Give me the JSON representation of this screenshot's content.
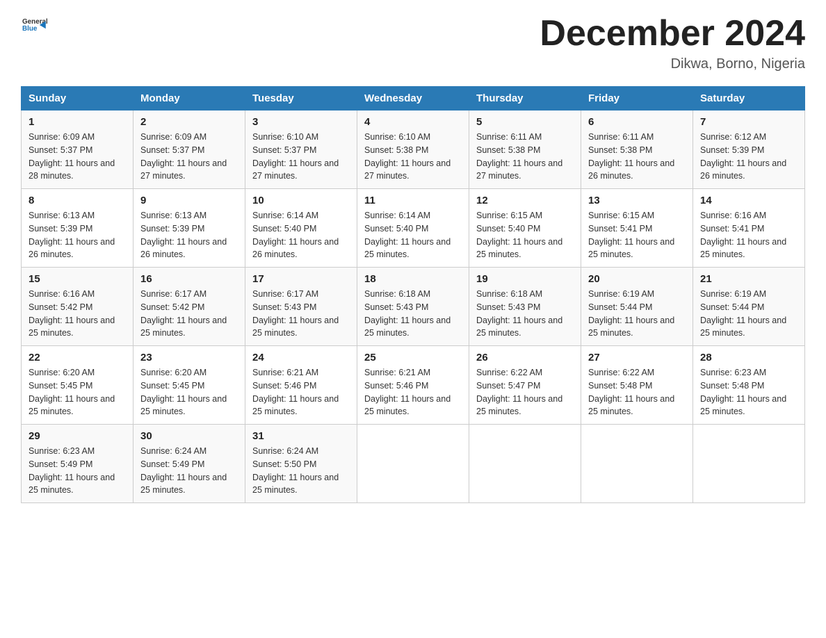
{
  "header": {
    "logo_general": "General",
    "logo_blue": "Blue",
    "month_title": "December 2024",
    "location": "Dikwa, Borno, Nigeria"
  },
  "weekdays": [
    "Sunday",
    "Monday",
    "Tuesday",
    "Wednesday",
    "Thursday",
    "Friday",
    "Saturday"
  ],
  "weeks": [
    [
      {
        "day": "1",
        "sunrise": "6:09 AM",
        "sunset": "5:37 PM",
        "daylight": "11 hours and 28 minutes."
      },
      {
        "day": "2",
        "sunrise": "6:09 AM",
        "sunset": "5:37 PM",
        "daylight": "11 hours and 27 minutes."
      },
      {
        "day": "3",
        "sunrise": "6:10 AM",
        "sunset": "5:37 PM",
        "daylight": "11 hours and 27 minutes."
      },
      {
        "day": "4",
        "sunrise": "6:10 AM",
        "sunset": "5:38 PM",
        "daylight": "11 hours and 27 minutes."
      },
      {
        "day": "5",
        "sunrise": "6:11 AM",
        "sunset": "5:38 PM",
        "daylight": "11 hours and 27 minutes."
      },
      {
        "day": "6",
        "sunrise": "6:11 AM",
        "sunset": "5:38 PM",
        "daylight": "11 hours and 26 minutes."
      },
      {
        "day": "7",
        "sunrise": "6:12 AM",
        "sunset": "5:39 PM",
        "daylight": "11 hours and 26 minutes."
      }
    ],
    [
      {
        "day": "8",
        "sunrise": "6:13 AM",
        "sunset": "5:39 PM",
        "daylight": "11 hours and 26 minutes."
      },
      {
        "day": "9",
        "sunrise": "6:13 AM",
        "sunset": "5:39 PM",
        "daylight": "11 hours and 26 minutes."
      },
      {
        "day": "10",
        "sunrise": "6:14 AM",
        "sunset": "5:40 PM",
        "daylight": "11 hours and 26 minutes."
      },
      {
        "day": "11",
        "sunrise": "6:14 AM",
        "sunset": "5:40 PM",
        "daylight": "11 hours and 25 minutes."
      },
      {
        "day": "12",
        "sunrise": "6:15 AM",
        "sunset": "5:40 PM",
        "daylight": "11 hours and 25 minutes."
      },
      {
        "day": "13",
        "sunrise": "6:15 AM",
        "sunset": "5:41 PM",
        "daylight": "11 hours and 25 minutes."
      },
      {
        "day": "14",
        "sunrise": "6:16 AM",
        "sunset": "5:41 PM",
        "daylight": "11 hours and 25 minutes."
      }
    ],
    [
      {
        "day": "15",
        "sunrise": "6:16 AM",
        "sunset": "5:42 PM",
        "daylight": "11 hours and 25 minutes."
      },
      {
        "day": "16",
        "sunrise": "6:17 AM",
        "sunset": "5:42 PM",
        "daylight": "11 hours and 25 minutes."
      },
      {
        "day": "17",
        "sunrise": "6:17 AM",
        "sunset": "5:43 PM",
        "daylight": "11 hours and 25 minutes."
      },
      {
        "day": "18",
        "sunrise": "6:18 AM",
        "sunset": "5:43 PM",
        "daylight": "11 hours and 25 minutes."
      },
      {
        "day": "19",
        "sunrise": "6:18 AM",
        "sunset": "5:43 PM",
        "daylight": "11 hours and 25 minutes."
      },
      {
        "day": "20",
        "sunrise": "6:19 AM",
        "sunset": "5:44 PM",
        "daylight": "11 hours and 25 minutes."
      },
      {
        "day": "21",
        "sunrise": "6:19 AM",
        "sunset": "5:44 PM",
        "daylight": "11 hours and 25 minutes."
      }
    ],
    [
      {
        "day": "22",
        "sunrise": "6:20 AM",
        "sunset": "5:45 PM",
        "daylight": "11 hours and 25 minutes."
      },
      {
        "day": "23",
        "sunrise": "6:20 AM",
        "sunset": "5:45 PM",
        "daylight": "11 hours and 25 minutes."
      },
      {
        "day": "24",
        "sunrise": "6:21 AM",
        "sunset": "5:46 PM",
        "daylight": "11 hours and 25 minutes."
      },
      {
        "day": "25",
        "sunrise": "6:21 AM",
        "sunset": "5:46 PM",
        "daylight": "11 hours and 25 minutes."
      },
      {
        "day": "26",
        "sunrise": "6:22 AM",
        "sunset": "5:47 PM",
        "daylight": "11 hours and 25 minutes."
      },
      {
        "day": "27",
        "sunrise": "6:22 AM",
        "sunset": "5:48 PM",
        "daylight": "11 hours and 25 minutes."
      },
      {
        "day": "28",
        "sunrise": "6:23 AM",
        "sunset": "5:48 PM",
        "daylight": "11 hours and 25 minutes."
      }
    ],
    [
      {
        "day": "29",
        "sunrise": "6:23 AM",
        "sunset": "5:49 PM",
        "daylight": "11 hours and 25 minutes."
      },
      {
        "day": "30",
        "sunrise": "6:24 AM",
        "sunset": "5:49 PM",
        "daylight": "11 hours and 25 minutes."
      },
      {
        "day": "31",
        "sunrise": "6:24 AM",
        "sunset": "5:50 PM",
        "daylight": "11 hours and 25 minutes."
      },
      null,
      null,
      null,
      null
    ]
  ]
}
